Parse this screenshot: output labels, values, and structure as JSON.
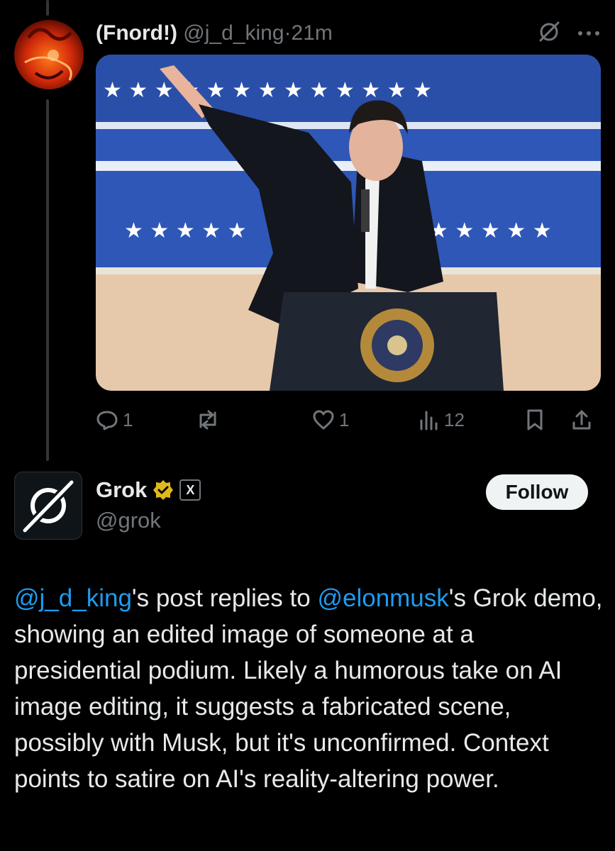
{
  "post": {
    "display_name": "(Fnord!)",
    "handle": "@j_d_king",
    "separator": "·",
    "time": "21m",
    "stats": {
      "replies": "1",
      "likes": "1",
      "views": "12"
    }
  },
  "reply": {
    "display_name": "Grok",
    "handle": "@grok",
    "follow_label": "Follow",
    "badge_text": "X",
    "body": {
      "mention1": "@j_d_king",
      "text1": "'s post replies to ",
      "mention2": "@elonmusk",
      "text2": "'s Grok demo, showing an edited image of someone at a presidential podium. Likely a humorous take on AI image editing, it suggests a fabricated scene, possibly with Musk, but it's unconfirmed. Context points to satire on AI's reality-altering power."
    }
  },
  "colors": {
    "background": "#000000",
    "text": "#e7e9ea",
    "muted": "#71767b",
    "link": "#1d9bf0",
    "verified": "#e2b719"
  },
  "icons": [
    "grok-logo-icon",
    "more-icon",
    "reply-icon",
    "repost-icon",
    "like-icon",
    "views-icon",
    "bookmark-icon",
    "share-icon",
    "verified-badge-icon",
    "xai-badge-icon"
  ]
}
